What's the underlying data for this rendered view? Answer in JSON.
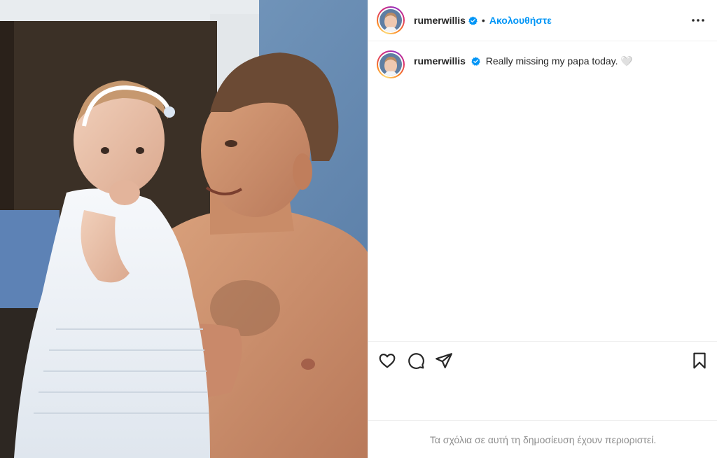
{
  "post": {
    "author": {
      "username": "rumerwillis",
      "verified": true,
      "follow_label": "Ακολουθήστε",
      "separator": "•"
    },
    "caption": {
      "username": "rumerwillis",
      "text": "Really missing my papa today. 🤍"
    },
    "actions": {
      "icons": [
        "heart-icon",
        "comment-icon",
        "share-icon",
        "bookmark-icon",
        "more-options-icon"
      ]
    },
    "comments_notice": "Τα σχόλια σε αυτή τη δημοσίευση έχουν περιοριστεί."
  },
  "colors": {
    "accent": "#0095f6",
    "verified": "#0095f6",
    "text": "#262626",
    "muted": "#8e8e8e",
    "divider": "#efefef"
  }
}
